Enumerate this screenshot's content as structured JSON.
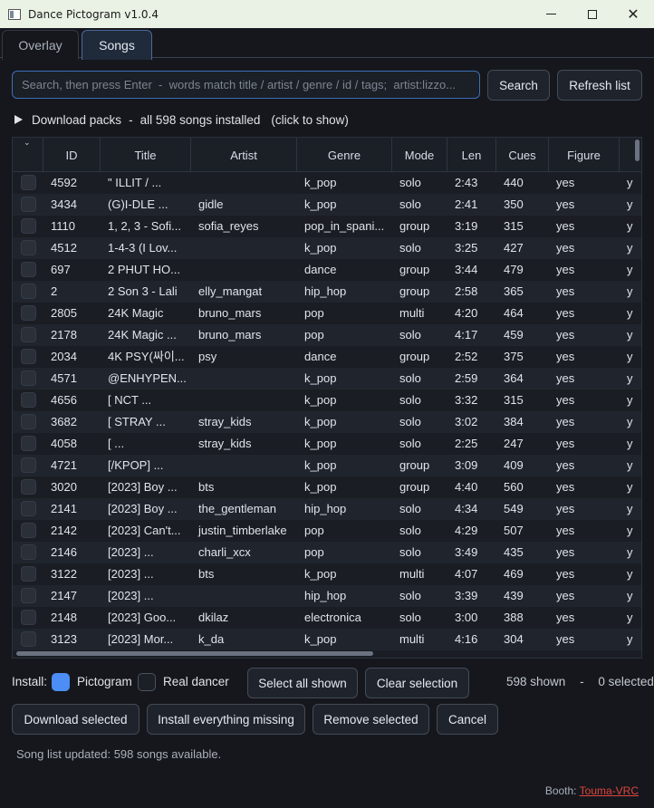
{
  "window": {
    "title": "Dance Pictogram v1.0.4"
  },
  "tabs": [
    {
      "label": "Overlay",
      "active": false
    },
    {
      "label": "Songs",
      "active": true
    }
  ],
  "search": {
    "placeholder": "Search, then press Enter  -  words match title / artist / genre / id / tags;  artist:lizzo...",
    "value": "",
    "button_label": "Search",
    "refresh_label": "Refresh list"
  },
  "packs": {
    "label": "Download packs",
    "separator": "-",
    "summary": "all 598 songs installed",
    "hint": "(click to show)"
  },
  "table": {
    "columns": [
      "ID",
      "Title",
      "Artist",
      "Genre",
      "Mode",
      "Len",
      "Cues",
      "Figure"
    ],
    "rows": [
      {
        "id": "4592",
        "title": "\" ILLIT / ...",
        "artist": "",
        "genre": "k_pop",
        "mode": "solo",
        "len": "2:43",
        "cues": "440",
        "figure": "yes",
        "extra": "y"
      },
      {
        "id": "3434",
        "title": "(G)I-DLE ...",
        "artist": "gidle",
        "genre": "k_pop",
        "mode": "solo",
        "len": "2:41",
        "cues": "350",
        "figure": "yes",
        "extra": "y"
      },
      {
        "id": "1110",
        "title": "1, 2, 3 - Sofi...",
        "artist": "sofia_reyes",
        "genre": "pop_in_spani...",
        "mode": "group",
        "len": "3:19",
        "cues": "315",
        "figure": "yes",
        "extra": "y"
      },
      {
        "id": "4512",
        "title": "1-4-3 (I Lov...",
        "artist": "",
        "genre": "k_pop",
        "mode": "solo",
        "len": "3:25",
        "cues": "427",
        "figure": "yes",
        "extra": "y"
      },
      {
        "id": "697",
        "title": "2 PHUT HO...",
        "artist": "",
        "genre": "dance",
        "mode": "group",
        "len": "3:44",
        "cues": "479",
        "figure": "yes",
        "extra": "y"
      },
      {
        "id": "2",
        "title": "2 Son 3 - Lali",
        "artist": "elly_mangat",
        "genre": "hip_hop",
        "mode": "group",
        "len": "2:58",
        "cues": "365",
        "figure": "yes",
        "extra": "y"
      },
      {
        "id": "2805",
        "title": "24K Magic",
        "artist": "bruno_mars",
        "genre": "pop",
        "mode": "multi",
        "len": "4:20",
        "cues": "464",
        "figure": "yes",
        "extra": "y"
      },
      {
        "id": "2178",
        "title": "24K Magic ...",
        "artist": "bruno_mars",
        "genre": "pop",
        "mode": "solo",
        "len": "4:17",
        "cues": "459",
        "figure": "yes",
        "extra": "y"
      },
      {
        "id": "2034",
        "title": "4K PSY(싸이...",
        "artist": "psy",
        "genre": "dance",
        "mode": "group",
        "len": "2:52",
        "cues": "375",
        "figure": "yes",
        "extra": "y"
      },
      {
        "id": "4571",
        "title": "@ENHYPEN...",
        "artist": "",
        "genre": "k_pop",
        "mode": "solo",
        "len": "2:59",
        "cues": "364",
        "figure": "yes",
        "extra": "y"
      },
      {
        "id": "4656",
        "title": "[ NCT ...",
        "artist": "",
        "genre": "k_pop",
        "mode": "solo",
        "len": "3:32",
        "cues": "315",
        "figure": "yes",
        "extra": "y"
      },
      {
        "id": "3682",
        "title": "[ STRAY ...",
        "artist": "stray_kids",
        "genre": "k_pop",
        "mode": "solo",
        "len": "3:02",
        "cues": "384",
        "figure": "yes",
        "extra": "y"
      },
      {
        "id": "4058",
        "title": "[ ...",
        "artist": "stray_kids",
        "genre": "k_pop",
        "mode": "solo",
        "len": "2:25",
        "cues": "247",
        "figure": "yes",
        "extra": "y"
      },
      {
        "id": "4721",
        "title": "[/KPOP] ...",
        "artist": "",
        "genre": "k_pop",
        "mode": "group",
        "len": "3:09",
        "cues": "409",
        "figure": "yes",
        "extra": "y"
      },
      {
        "id": "3020",
        "title": "[2023] Boy ...",
        "artist": "bts",
        "genre": "k_pop",
        "mode": "group",
        "len": "4:40",
        "cues": "560",
        "figure": "yes",
        "extra": "y"
      },
      {
        "id": "2141",
        "title": "[2023] Boy ...",
        "artist": "the_gentleman",
        "genre": "hip_hop",
        "mode": "solo",
        "len": "4:34",
        "cues": "549",
        "figure": "yes",
        "extra": "y"
      },
      {
        "id": "2142",
        "title": "[2023] Can't...",
        "artist": "justin_timberlake",
        "genre": "pop",
        "mode": "solo",
        "len": "4:29",
        "cues": "507",
        "figure": "yes",
        "extra": "y"
      },
      {
        "id": "2146",
        "title": "[2023] ...",
        "artist": "charli_xcx",
        "genre": "pop",
        "mode": "solo",
        "len": "3:49",
        "cues": "435",
        "figure": "yes",
        "extra": "y"
      },
      {
        "id": "3122",
        "title": "[2023] ...",
        "artist": "bts",
        "genre": "k_pop",
        "mode": "multi",
        "len": "4:07",
        "cues": "469",
        "figure": "yes",
        "extra": "y"
      },
      {
        "id": "2147",
        "title": "[2023] ...",
        "artist": "",
        "genre": "hip_hop",
        "mode": "solo",
        "len": "3:39",
        "cues": "439",
        "figure": "yes",
        "extra": "y"
      },
      {
        "id": "2148",
        "title": "[2023] Goo...",
        "artist": "dkilaz",
        "genre": "electronica",
        "mode": "solo",
        "len": "3:00",
        "cues": "388",
        "figure": "yes",
        "extra": "y"
      },
      {
        "id": "3123",
        "title": "[2023] Mor...",
        "artist": "k_da",
        "genre": "k_pop",
        "mode": "multi",
        "len": "4:16",
        "cues": "304",
        "figure": "yes",
        "extra": "y"
      }
    ]
  },
  "install": {
    "label": "Install:",
    "pictogram_label": "Pictogram",
    "pictogram_checked": true,
    "real_dancer_label": "Real dancer",
    "real_dancer_checked": false,
    "select_all_label": "Select all shown",
    "clear_label": "Clear selection",
    "shown_count": "598 shown",
    "count_separator": "-",
    "selected_count": "0 selected"
  },
  "actions": {
    "download_selected": "Download selected",
    "install_missing": "Install everything missing",
    "remove_selected": "Remove selected",
    "cancel": "Cancel"
  },
  "status": "Song list updated: 598 songs available.",
  "footer": {
    "booth_label": "Booth:",
    "booth_link": "Touma-VRC"
  },
  "colors": {
    "accent": "#4c8df6",
    "link": "#e0453e",
    "background": "#15171c"
  }
}
